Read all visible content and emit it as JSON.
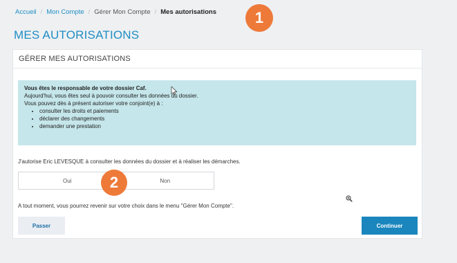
{
  "breadcrumb": {
    "items": [
      "Accueil",
      "Mon Compte",
      "Gérer Mon Compte",
      "Mes autorisations"
    ],
    "separator": "/"
  },
  "page": {
    "title": "MES AUTORISATIONS"
  },
  "panel": {
    "header": "GÉRER MES AUTORISATIONS"
  },
  "info": {
    "title": "Vous êtes le responsable de votre dossier Caf.",
    "line1": "Aujourd'hui, vous êtes seul à pouvoir consulter les données du dossier.",
    "line2": "Vous pouvez dès à présent autoriser votre conjoint(e) à :",
    "bullets": [
      "consulter les droits et paiements",
      "déclarer des changements",
      "demander une prestation"
    ]
  },
  "consent": {
    "text": "J'autorise Eric LEVESQUE à consulter les données du dossier et à réaliser les démarches.",
    "yes_label": "Oui",
    "no_label": "Non"
  },
  "reminder": "A tout moment, vous pourrez revenir sur votre choix dans le menu \"Gérer Mon Compte\".",
  "actions": {
    "skip_label": "Passer",
    "continue_label": "Continuer"
  },
  "annotations": {
    "marker1": "1",
    "marker2": "2"
  },
  "colors": {
    "accent": "#1f8dc4",
    "info_bg": "#c5e6ea",
    "primary_button": "#1a86bd",
    "marker": "#ee7a3a"
  },
  "icons": {
    "cursor": "cursor-icon",
    "zoom": "zoom-icon"
  }
}
